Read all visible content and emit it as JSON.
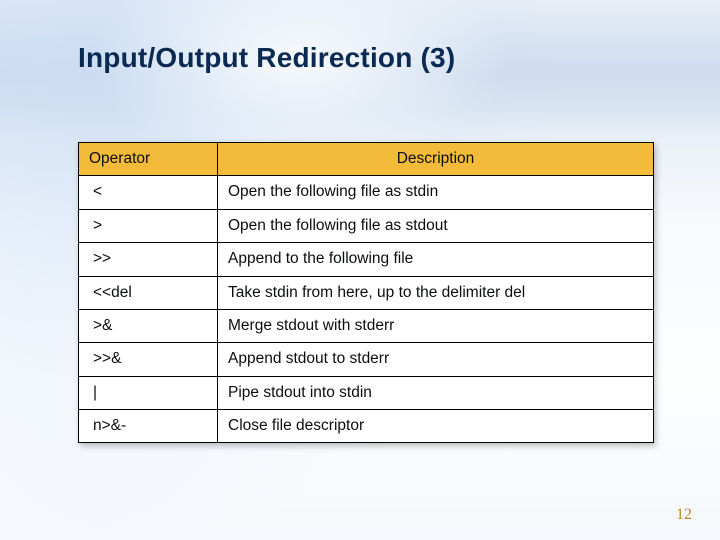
{
  "title": "Input/Output Redirection (3)",
  "page_number": "12",
  "table": {
    "headers": {
      "operator": "Operator",
      "description": "Description"
    },
    "rows": [
      {
        "op": "<",
        "desc": "Open the following file as stdin"
      },
      {
        "op": ">",
        "desc": "Open the following file as stdout"
      },
      {
        "op": ">>",
        "desc": "Append to the following file"
      },
      {
        "op": "<<del",
        "desc": "Take stdin from here, up to the delimiter del"
      },
      {
        "op": ">&",
        "desc": "Merge stdout with stderr"
      },
      {
        "op": ">>&",
        "desc": "Append stdout to stderr"
      },
      {
        "op": "|",
        "desc": "Pipe stdout into stdin"
      },
      {
        "op": "n>&-",
        "desc": "Close file descriptor"
      }
    ]
  }
}
